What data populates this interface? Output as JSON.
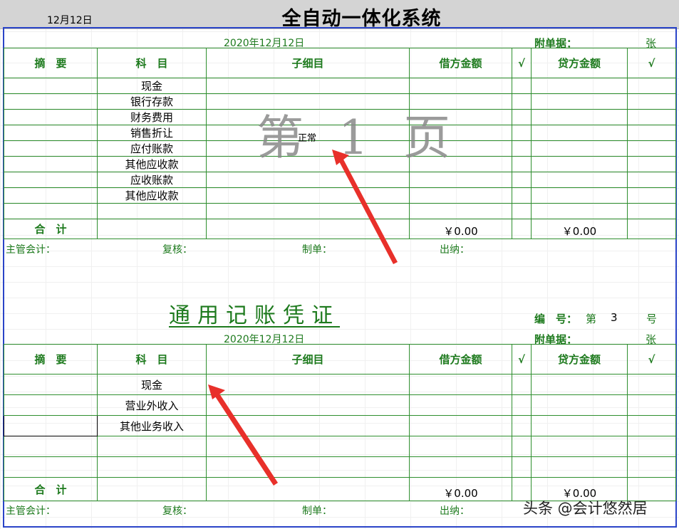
{
  "top": {
    "date": "12月12日",
    "system_title": "全自动一体化系统"
  },
  "voucher1": {
    "date": "2020年12月12日",
    "attach_label": "附单据：",
    "attach_unit": "张",
    "columns": [
      "摘　要",
      "科　目",
      "子细目",
      "借方金额",
      "√",
      "贷方金额",
      "√"
    ],
    "rows": [
      {
        "subject": "现金"
      },
      {
        "subject": "银行存款"
      },
      {
        "subject": "财务费用"
      },
      {
        "subject": "销售折让"
      },
      {
        "subject": "应付账款"
      },
      {
        "subject": "其他应收款"
      },
      {
        "subject": "应收账款"
      },
      {
        "subject": "其他应收款"
      },
      {
        "subject": ""
      }
    ],
    "total_label": "合　计",
    "debit_total": "￥0.00",
    "credit_total": "￥0.00",
    "watermark": "第 1 页",
    "status_tag": "正常",
    "signatures": {
      "supervisor": "主管会计：",
      "review": "复核：",
      "maker": "制单：",
      "cashier": "出纳："
    }
  },
  "voucher2": {
    "title": "通用记账凭证",
    "number_label": "编　号：",
    "number_prefix": "第",
    "number_value": "3",
    "number_suffix": "号",
    "date": "2020年12月12日",
    "attach_label": "附单据：",
    "attach_unit": "张",
    "columns": [
      "摘　要",
      "科　目",
      "子细目",
      "借方金额",
      "√",
      "贷方金额",
      "√"
    ],
    "rows": [
      {
        "subject": "现金"
      },
      {
        "subject": "营业外收入"
      },
      {
        "subject": "其他业务收入"
      },
      {
        "subject": ""
      },
      {
        "subject": ""
      }
    ],
    "total_label": "合　计",
    "debit_total": "￥0.00",
    "credit_total": "￥0.00",
    "signatures": {
      "supervisor": "主管会计：",
      "review": "复核：",
      "maker": "制单：",
      "cashier": "出纳："
    }
  },
  "footer": {
    "watermark_text": "头条 @会计悠然居"
  },
  "colors": {
    "accent_green": "#1d7a1d",
    "border_blue": "#2a44c8",
    "arrow_red": "#e8302a"
  }
}
